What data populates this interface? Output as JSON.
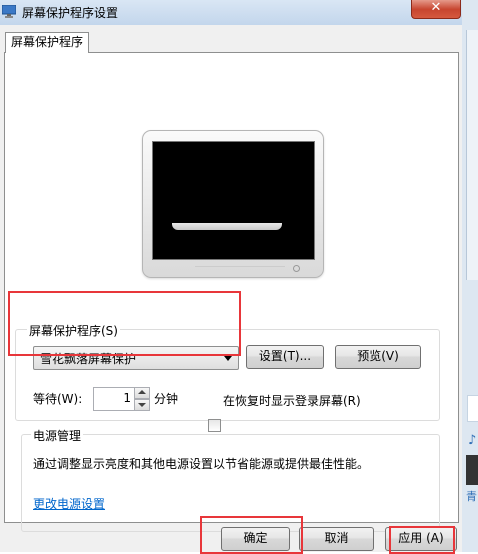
{
  "window": {
    "title": "屏幕保护程序设置",
    "close_label": "✕"
  },
  "tabs": [
    {
      "label": "屏幕保护程序"
    }
  ],
  "screensaver": {
    "group_label": "屏幕保护程序(S)",
    "selected": "雪花飘落屏幕保护",
    "settings_button": "设置(T)...",
    "preview_button": "预览(V)",
    "wait_label": "等待(W):",
    "wait_value": "1",
    "wait_unit": "分钟",
    "resume_checkbox_label": "在恢复时显示登录屏幕(R)",
    "resume_checked": false
  },
  "power": {
    "group_label": "电源管理",
    "description": "通过调整显示亮度和其他电源设置以节省能源或提供最佳性能。",
    "link": "更改电源设置"
  },
  "footer": {
    "ok": "确定",
    "cancel": "取消",
    "apply": "应用 (A)"
  },
  "background_window": {
    "snippet": "青"
  },
  "colors": {
    "highlight_box": "#e8363a",
    "link": "#0066cc",
    "close_button": "#c7452f"
  }
}
